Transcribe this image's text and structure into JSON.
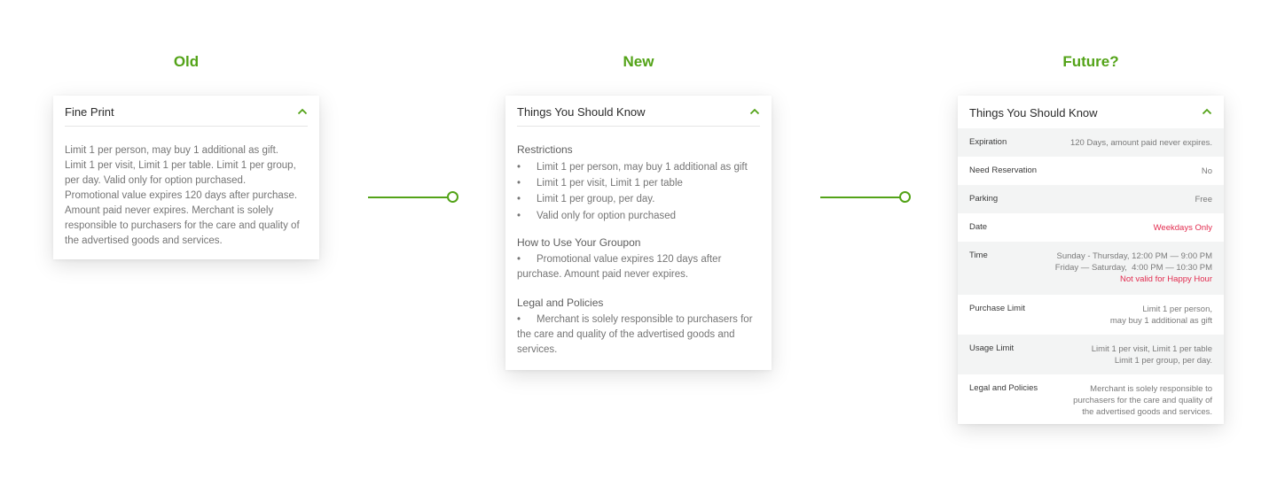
{
  "labels": {
    "old": "Old",
    "new": "New",
    "future": "Future?"
  },
  "colors": {
    "accent": "#53a318",
    "alert": "#e22c4f",
    "row_shade": "#f3f4f4"
  },
  "old_card": {
    "title": "Fine Print",
    "collapse_icon": "chevron-up-icon",
    "lines": [
      "Limit 1 per person, may buy 1 additional as gift.",
      "Limit 1 per visit, Limit 1 per table. Limit 1 per group,",
      "per day. Valid only for option purchased.",
      "Promotional value expires 120 days after purchase.",
      "Amount paid never expires. Merchant is solely",
      "responsible to purchasers for the care and quality of",
      "the advertised goods and services."
    ]
  },
  "new_card": {
    "title": "Things You Should Know",
    "collapse_icon": "chevron-up-icon",
    "bullet": "•",
    "restrictions": {
      "title": "Restrictions",
      "items": [
        "Limit 1 per person, may buy 1 additional as gift",
        "Limit 1 per visit, Limit 1 per table",
        "Limit 1 per group, per day.",
        "Valid only for option purchased"
      ]
    },
    "how_to_use": {
      "title": "How to Use Your Groupon",
      "line1": "Promotional value expires 120 days after",
      "line2": "purchase. Amount paid never expires."
    },
    "legal": {
      "title": "Legal and Policies",
      "line1": "Merchant is solely responsible to purchasers for",
      "line2": "the care and quality of the advertised goods and",
      "line3": "services."
    }
  },
  "future_card": {
    "title": "Things You Should Know",
    "collapse_icon": "chevron-up-icon",
    "rows": {
      "expiration": {
        "label": "Expiration",
        "value": "120 Days, amount paid never expires."
      },
      "reservation": {
        "label": "Need Reservation",
        "value": "No"
      },
      "parking": {
        "label": "Parking",
        "value": "Free"
      },
      "date": {
        "label": "Date",
        "value": "Weekdays Only"
      },
      "time": {
        "label": "Time",
        "line1": "Sunday - Thursday, 12:00 PM — 9:00 PM",
        "line2": "Friday — Saturday,  4:00 PM — 10:30 PM",
        "note": "Not valid for Happy Hour"
      },
      "purchase_limit": {
        "label": "Purchase Limit",
        "line1": "Limit 1 per person,",
        "line2": "may buy 1 additional as gift"
      },
      "usage_limit": {
        "label": "Usage Limit",
        "line1": "Limit 1 per visit, Limit 1 per table",
        "line2": "Limit 1 per group, per day."
      },
      "legal": {
        "label": "Legal and Policies",
        "line1": "Merchant is solely responsible to",
        "line2": "purchasers for the care and quality of",
        "line3": "the advertised goods and services."
      }
    }
  }
}
